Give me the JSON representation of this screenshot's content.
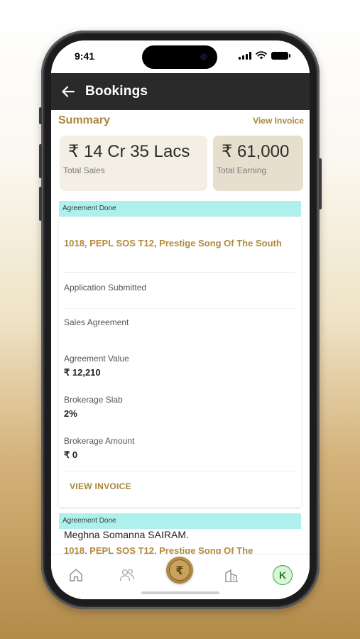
{
  "status_bar": {
    "time": "9:41"
  },
  "header": {
    "title": "Bookings"
  },
  "summary": {
    "title": "Summary",
    "view_invoice": "View Invoice",
    "total_sales_value": "₹ 14 Cr 35 Lacs",
    "total_sales_label": "Total Sales",
    "total_earning_value": "₹ 61,000",
    "total_earning_label": "Total Earning"
  },
  "bookings": [
    {
      "status": "Agreement Done",
      "property": "1018, PEPL SOS T12, Prestige Song Of The South",
      "application_label": "Application Submitted",
      "sales_agreement_label": "Sales Agreement",
      "agreement_value_label": "Agreement Value",
      "agreement_value": "₹ 12,210",
      "brokerage_slab_label": "Brokerage Slab",
      "brokerage_slab": "2%",
      "brokerage_amount_label": "Brokerage Amount",
      "brokerage_amount": "₹ 0",
      "invoice_button": "VIEW INVOICE"
    },
    {
      "status": "Agreement Done",
      "customer": "Meghna Somanna SAIRAM.",
      "property": "1018, PEPL SOS T12, Prestige Song Of The"
    }
  ],
  "bottom_nav": {
    "items": [
      "home-icon",
      "users-icon",
      "rupee-icon",
      "building-icon",
      "profile-avatar"
    ],
    "avatar_letter": "K"
  },
  "colors": {
    "accent": "#a8873e",
    "header_bg": "#2a2a2b",
    "status_strip": "#aef0ec",
    "sales_card": "#f3efe4",
    "earning_card": "#e7dfcd"
  }
}
